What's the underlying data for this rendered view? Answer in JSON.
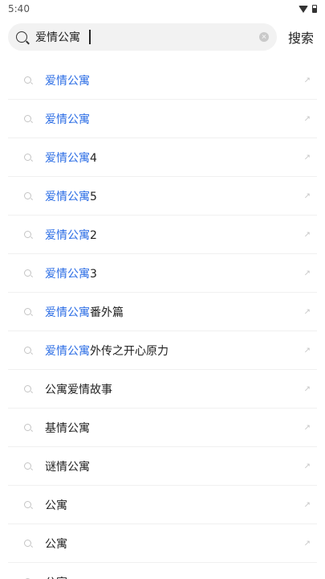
{
  "status_bar": {
    "time": "5:40"
  },
  "search": {
    "query": "爱情公寓",
    "button_label": "搜索"
  },
  "results": [
    {
      "highlight": "爱情公寓",
      "rest": ""
    },
    {
      "highlight": "爱情公寓",
      "rest": ""
    },
    {
      "highlight": "爱情公寓",
      "rest": "4"
    },
    {
      "highlight": "爱情公寓",
      "rest": "5"
    },
    {
      "highlight": "爱情公寓",
      "rest": "2"
    },
    {
      "highlight": "爱情公寓",
      "rest": "3"
    },
    {
      "highlight": "爱情公寓",
      "rest": "番外篇"
    },
    {
      "highlight": "爱情公寓",
      "rest": "外传之开心原力"
    },
    {
      "highlight": "",
      "rest": "公寓爱情故事"
    },
    {
      "highlight": "",
      "rest": "基情公寓"
    },
    {
      "highlight": "",
      "rest": "谜情公寓"
    },
    {
      "highlight": "",
      "rest": "公寓"
    },
    {
      "highlight": "",
      "rest": "公寓"
    },
    {
      "highlight": "",
      "rest": "公寓"
    }
  ],
  "colors": {
    "highlight": "#2b6de5",
    "text": "#222222",
    "search_bg": "#f2f2f2"
  },
  "icons": {
    "search": "search-icon",
    "clear": "clear-icon",
    "fill_arrow": "arrow-up-left-icon"
  }
}
